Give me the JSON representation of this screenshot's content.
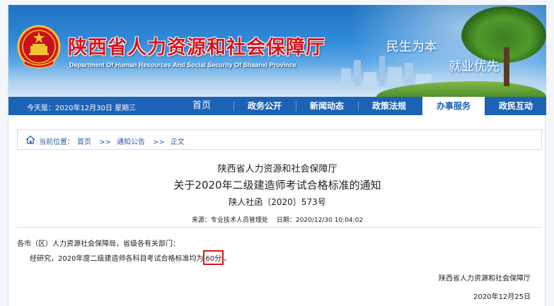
{
  "header": {
    "title": "陕西省人力资源和社会保障厅",
    "subtitle": "Department Of Human Resources And Social Security Of Shaanxi Province",
    "slogan_line1": "民生为本",
    "slogan_line2": "就业优先"
  },
  "nav": {
    "date_text": "今天是：2020年12月30日  星期三",
    "items": [
      {
        "label": "首页"
      },
      {
        "label": "政务公开"
      },
      {
        "label": "新闻动态"
      },
      {
        "label": "政策法规"
      },
      {
        "label": "办事服务"
      },
      {
        "label": "政民互动"
      }
    ],
    "active_index": 4
  },
  "breadcrumb": {
    "label": "当前位置：",
    "items": [
      "首页",
      "通知公告",
      "正文"
    ],
    "separator": ">>"
  },
  "article": {
    "issuer": "陕西省人力资源和社会保障厅",
    "title": "关于2020年二级建造师考试合格标准的通知",
    "doc_number": "陕人社函〔2020〕573号",
    "source_label": "来源：专业技术人员管理处",
    "date_label": "日期：2020/12/30 10:04:02",
    "addressee": "各市（区）人力资源社会保障局，省级各有关部门：",
    "body_prefix": "经研究，2020年度二级建造师各科目考试合格标准均为",
    "body_highlight": "60分",
    "body_suffix": "。",
    "signature": "陕西省人力资源和社会保障厅",
    "sign_date": "2020年12月25日"
  },
  "colors": {
    "nav_bg": "#1d63b5",
    "title_red": "#d8141b",
    "highlight_box": "#e0141b"
  }
}
